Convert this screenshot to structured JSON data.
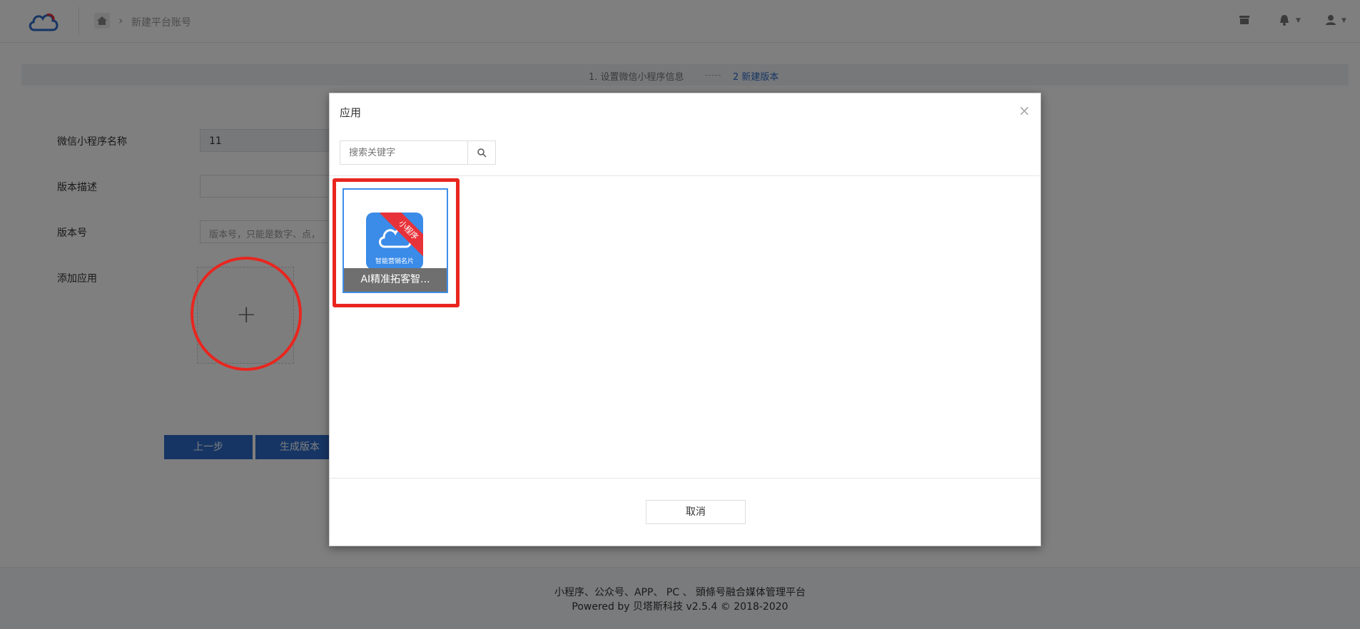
{
  "header": {
    "breadcrumb": "新建平台账号",
    "icons": [
      "cloud-logo-icon",
      "home-icon",
      "store-icon",
      "bell-icon",
      "user-icon"
    ]
  },
  "steps": {
    "step1": "1. 设置微信小程序信息",
    "step2": "2 新建版本"
  },
  "form": {
    "name_label": "微信小程序名称",
    "name_value": "11",
    "desc_label": "版本描述",
    "desc_value": "",
    "version_label": "版本号",
    "version_placeholder": "版本号，只能是数字、点，",
    "add_app_label": "添加应用",
    "add_plus": "+"
  },
  "buttons": {
    "prev": "上一步",
    "generate": "生成版本"
  },
  "footer": {
    "line1": "小程序、公众号、APP、 PC 、 頭條号融合媒体管理平台",
    "line2": "Powered by 贝塔斯科技 v2.5.4 © 2018-2020"
  },
  "modal": {
    "title": "应用",
    "close": "×",
    "search_placeholder": "搜索关键字",
    "apps": [
      {
        "name": "AI精准拓客智...",
        "ribbon": "小程序",
        "icon_caption": "智能营销名片"
      }
    ],
    "cancel": "取消"
  },
  "colors": {
    "primary": "#2d6ac8",
    "annotation": "#e8261f",
    "app_icon_bg": "#3b8be8",
    "ribbon": "#e8323a"
  }
}
